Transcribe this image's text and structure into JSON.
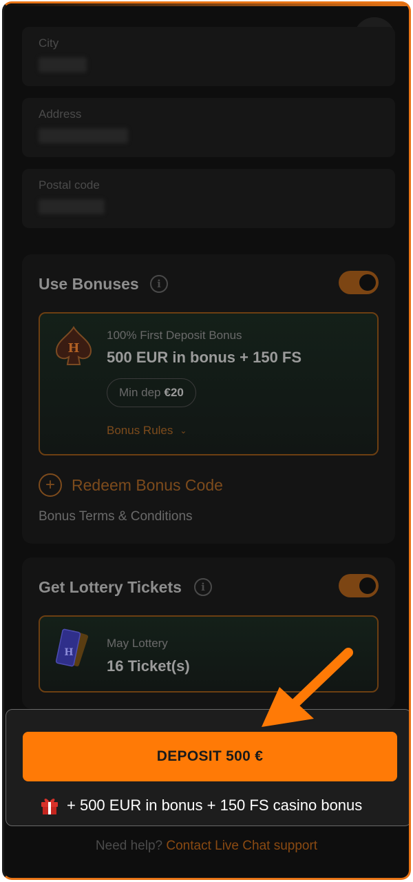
{
  "form": {
    "city_label": "City",
    "address_label": "Address",
    "postal_label": "Postal code"
  },
  "bonuses": {
    "title": "Use Bonuses",
    "enabled": true,
    "offer": {
      "subtitle": "100% First Deposit Bonus",
      "title": "500 EUR in bonus + 150 FS",
      "min_dep_prefix": "Min dep",
      "min_dep_value": "€20",
      "rules_label": "Bonus Rules"
    },
    "redeem_label": "Redeem Bonus Code",
    "terms_label": "Bonus Terms & Conditions"
  },
  "lottery": {
    "title": "Get Lottery Tickets",
    "enabled": true,
    "subtitle": "May Lottery",
    "tickets": "16 Ticket(s)"
  },
  "footer": {
    "deposit_label": "DEPOSIT 500 €",
    "bonus_summary": "+ 500 EUR in bonus + 150 FS casino bonus",
    "help_prefix": "Need help?",
    "help_link": "Contact Live Chat support"
  },
  "icons": {
    "close": "close-icon",
    "info": "info-icon",
    "bonus_logo": "spade-logo-icon",
    "lottery_logo": "ticket-icon",
    "gift": "gift-icon",
    "plus": "plus-circle-icon",
    "annotation": "arrow-icon"
  },
  "colors": {
    "accent": "#ff7a06",
    "background": "#0e0e0e"
  }
}
